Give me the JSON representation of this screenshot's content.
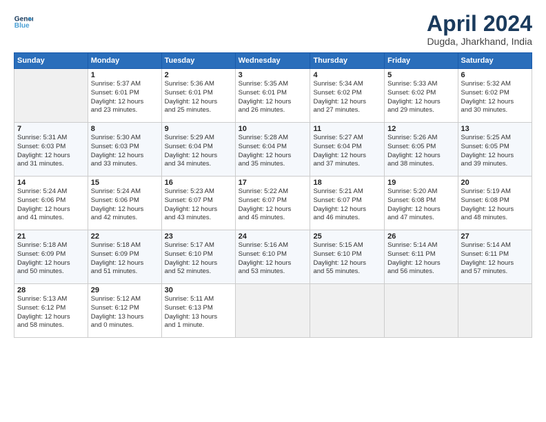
{
  "header": {
    "logo_line1": "General",
    "logo_line2": "Blue",
    "month": "April 2024",
    "location": "Dugda, Jharkhand, India"
  },
  "weekdays": [
    "Sunday",
    "Monday",
    "Tuesday",
    "Wednesday",
    "Thursday",
    "Friday",
    "Saturday"
  ],
  "weeks": [
    [
      {
        "day": "",
        "info": ""
      },
      {
        "day": "1",
        "info": "Sunrise: 5:37 AM\nSunset: 6:01 PM\nDaylight: 12 hours\nand 23 minutes."
      },
      {
        "day": "2",
        "info": "Sunrise: 5:36 AM\nSunset: 6:01 PM\nDaylight: 12 hours\nand 25 minutes."
      },
      {
        "day": "3",
        "info": "Sunrise: 5:35 AM\nSunset: 6:01 PM\nDaylight: 12 hours\nand 26 minutes."
      },
      {
        "day": "4",
        "info": "Sunrise: 5:34 AM\nSunset: 6:02 PM\nDaylight: 12 hours\nand 27 minutes."
      },
      {
        "day": "5",
        "info": "Sunrise: 5:33 AM\nSunset: 6:02 PM\nDaylight: 12 hours\nand 29 minutes."
      },
      {
        "day": "6",
        "info": "Sunrise: 5:32 AM\nSunset: 6:02 PM\nDaylight: 12 hours\nand 30 minutes."
      }
    ],
    [
      {
        "day": "7",
        "info": "Sunrise: 5:31 AM\nSunset: 6:03 PM\nDaylight: 12 hours\nand 31 minutes."
      },
      {
        "day": "8",
        "info": "Sunrise: 5:30 AM\nSunset: 6:03 PM\nDaylight: 12 hours\nand 33 minutes."
      },
      {
        "day": "9",
        "info": "Sunrise: 5:29 AM\nSunset: 6:04 PM\nDaylight: 12 hours\nand 34 minutes."
      },
      {
        "day": "10",
        "info": "Sunrise: 5:28 AM\nSunset: 6:04 PM\nDaylight: 12 hours\nand 35 minutes."
      },
      {
        "day": "11",
        "info": "Sunrise: 5:27 AM\nSunset: 6:04 PM\nDaylight: 12 hours\nand 37 minutes."
      },
      {
        "day": "12",
        "info": "Sunrise: 5:26 AM\nSunset: 6:05 PM\nDaylight: 12 hours\nand 38 minutes."
      },
      {
        "day": "13",
        "info": "Sunrise: 5:25 AM\nSunset: 6:05 PM\nDaylight: 12 hours\nand 39 minutes."
      }
    ],
    [
      {
        "day": "14",
        "info": "Sunrise: 5:24 AM\nSunset: 6:06 PM\nDaylight: 12 hours\nand 41 minutes."
      },
      {
        "day": "15",
        "info": "Sunrise: 5:24 AM\nSunset: 6:06 PM\nDaylight: 12 hours\nand 42 minutes."
      },
      {
        "day": "16",
        "info": "Sunrise: 5:23 AM\nSunset: 6:07 PM\nDaylight: 12 hours\nand 43 minutes."
      },
      {
        "day": "17",
        "info": "Sunrise: 5:22 AM\nSunset: 6:07 PM\nDaylight: 12 hours\nand 45 minutes."
      },
      {
        "day": "18",
        "info": "Sunrise: 5:21 AM\nSunset: 6:07 PM\nDaylight: 12 hours\nand 46 minutes."
      },
      {
        "day": "19",
        "info": "Sunrise: 5:20 AM\nSunset: 6:08 PM\nDaylight: 12 hours\nand 47 minutes."
      },
      {
        "day": "20",
        "info": "Sunrise: 5:19 AM\nSunset: 6:08 PM\nDaylight: 12 hours\nand 48 minutes."
      }
    ],
    [
      {
        "day": "21",
        "info": "Sunrise: 5:18 AM\nSunset: 6:09 PM\nDaylight: 12 hours\nand 50 minutes."
      },
      {
        "day": "22",
        "info": "Sunrise: 5:18 AM\nSunset: 6:09 PM\nDaylight: 12 hours\nand 51 minutes."
      },
      {
        "day": "23",
        "info": "Sunrise: 5:17 AM\nSunset: 6:10 PM\nDaylight: 12 hours\nand 52 minutes."
      },
      {
        "day": "24",
        "info": "Sunrise: 5:16 AM\nSunset: 6:10 PM\nDaylight: 12 hours\nand 53 minutes."
      },
      {
        "day": "25",
        "info": "Sunrise: 5:15 AM\nSunset: 6:10 PM\nDaylight: 12 hours\nand 55 minutes."
      },
      {
        "day": "26",
        "info": "Sunrise: 5:14 AM\nSunset: 6:11 PM\nDaylight: 12 hours\nand 56 minutes."
      },
      {
        "day": "27",
        "info": "Sunrise: 5:14 AM\nSunset: 6:11 PM\nDaylight: 12 hours\nand 57 minutes."
      }
    ],
    [
      {
        "day": "28",
        "info": "Sunrise: 5:13 AM\nSunset: 6:12 PM\nDaylight: 12 hours\nand 58 minutes."
      },
      {
        "day": "29",
        "info": "Sunrise: 5:12 AM\nSunset: 6:12 PM\nDaylight: 13 hours\nand 0 minutes."
      },
      {
        "day": "30",
        "info": "Sunrise: 5:11 AM\nSunset: 6:13 PM\nDaylight: 13 hours\nand 1 minute."
      },
      {
        "day": "",
        "info": ""
      },
      {
        "day": "",
        "info": ""
      },
      {
        "day": "",
        "info": ""
      },
      {
        "day": "",
        "info": ""
      }
    ]
  ]
}
